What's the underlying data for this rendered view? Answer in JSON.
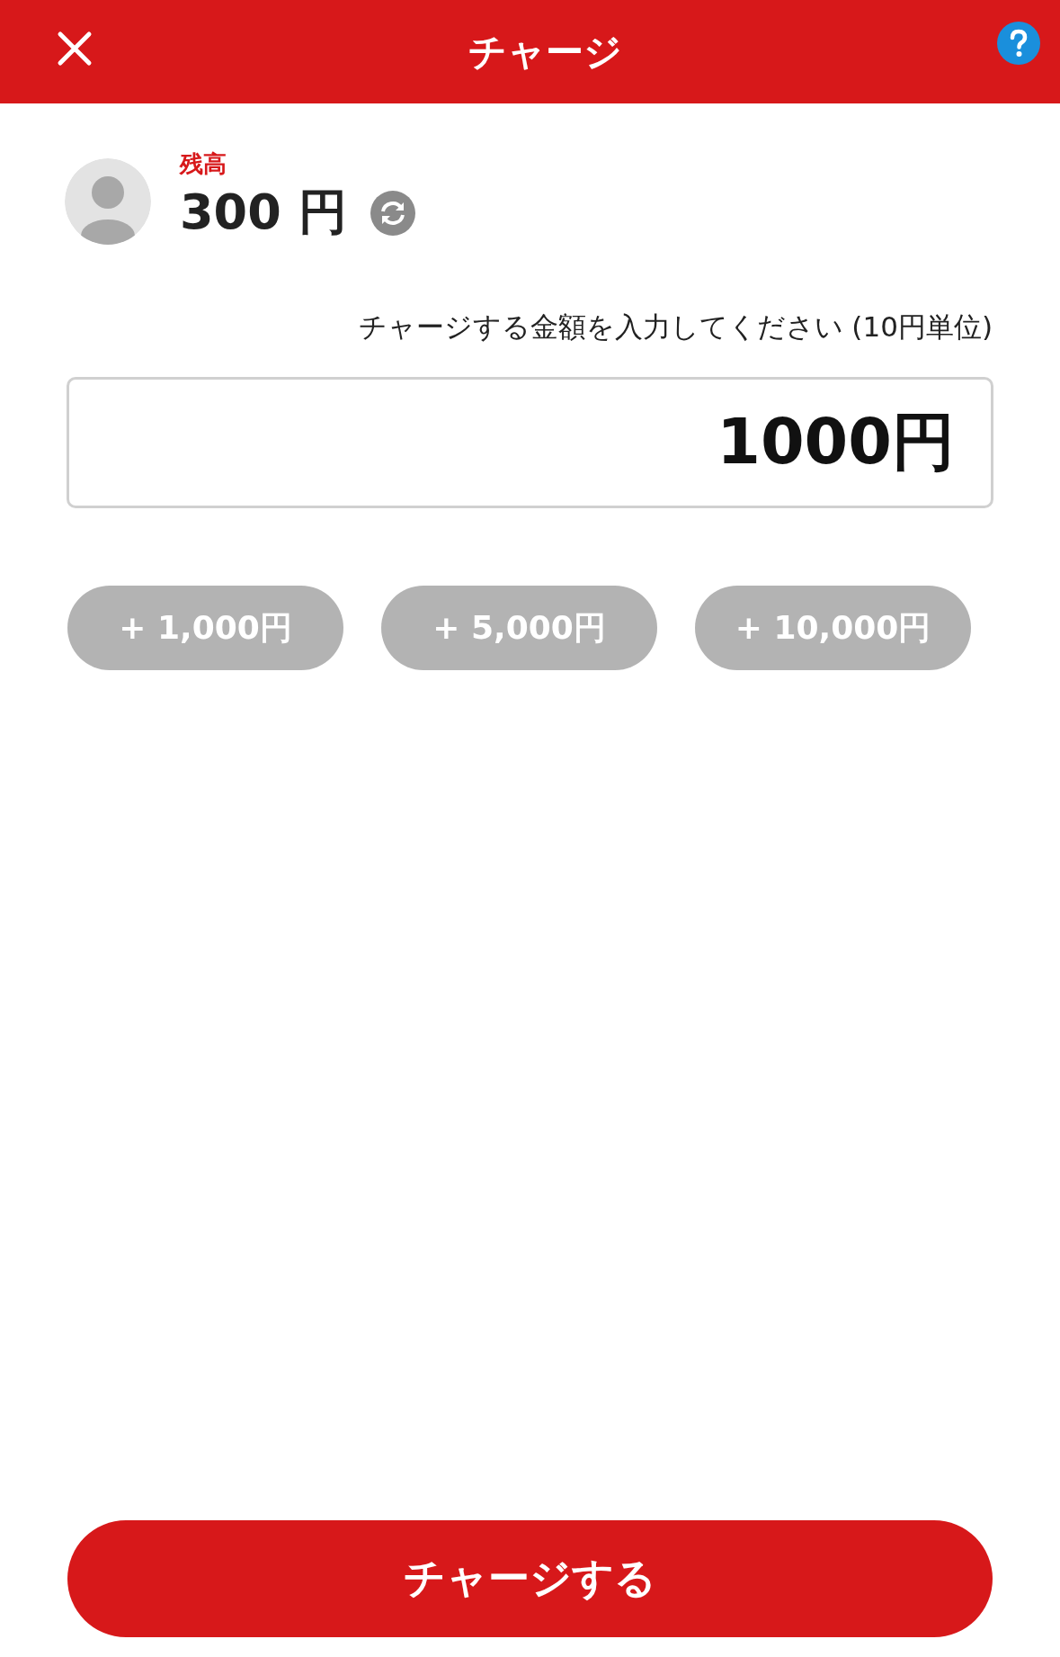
{
  "header": {
    "title": "チャージ"
  },
  "balance": {
    "label": "残高",
    "amount": "300 円"
  },
  "instruction": "チャージする金額を入力してください (10円単位)",
  "amount_field": {
    "value": "1000円"
  },
  "quick_add": [
    "+ 1,000円",
    "+ 5,000円",
    "+ 10,000円"
  ],
  "submit": {
    "label": "チャージする"
  }
}
